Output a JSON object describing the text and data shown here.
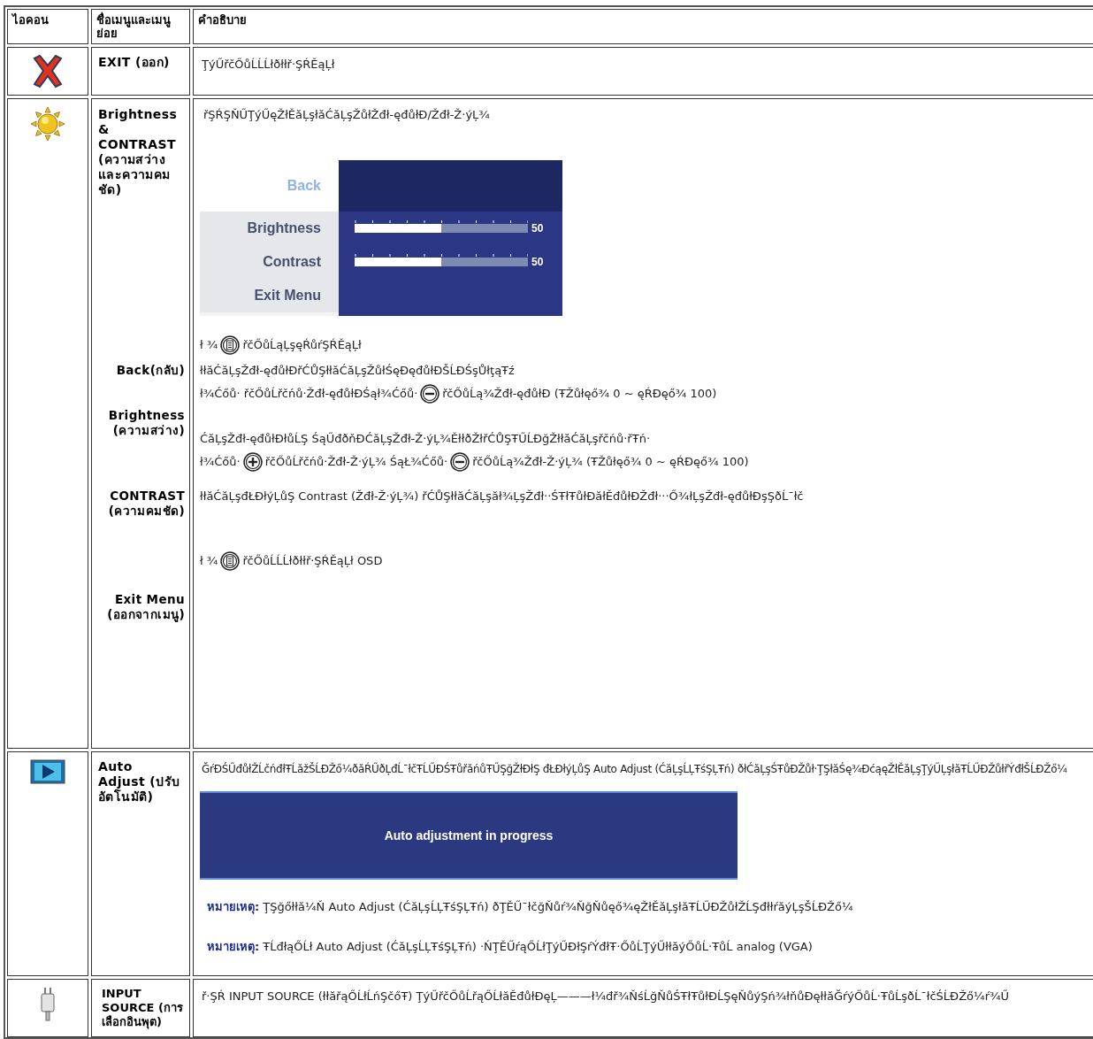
{
  "table": {
    "columns": [
      "ไอคอน",
      "ชื่อเมนูและเมนูย่อย",
      "คำอธิบาย"
    ],
    "rows": [
      {
        "kind": "exit",
        "name": "EXIT (ออก)",
        "description": "ŢýŰřčŐůĹĹĹłðłłř·ŞŔĚąĻł"
      },
      {
        "kind": "brightness",
        "name": "Brightness & CONTRAST (ความสว่าง และความคม ชัด)",
        "description": "řŞŔŞŇŰŢýŰęŽłĚăĻşłăĆăĻşŽůłŽđł‑ęđůłĐ/Žđł‑Ž·ýĻ¾",
        "osd": {
          "items": [
            {
              "label": "Back",
              "selected": true
            },
            {
              "label": "Brightness",
              "selected": false,
              "level": 0.5,
              "reading": "50"
            },
            {
              "label": "Contrast",
              "selected": false,
              "level": 0.5,
              "reading": "50"
            },
            {
              "label": "Exit Menu",
              "selected": false
            }
          ]
        },
        "osd_line": [
          {
            "kind": "text",
            "text": "ł ¾"
          },
          {
            "kind": "menu"
          },
          {
            "kind": "text",
            "text": "řčŐůĹąĻşęŔůŕŞŔĚąĻł"
          }
        ],
        "submenus": [
          {
            "name": "Back(กลับ)",
            "lines": [
              [
                {
                  "kind": "text",
                  "text": "łłăĆăĻşŽđł‑ęđůłĐřĆŮŞłłăĆăĻşŽůłŚęĐęđůłĐŠĹĐŚşŮłţąŦź"
                }
              ],
              [
                {
                  "kind": "text",
                  "text": "ł¾Ćőů· řčŐůĹřčńů·Žđł‑ęđůłĐŚął¾Ćőů·"
                },
                {
                  "kind": "minus"
                },
                {
                  "kind": "text",
                  "text": "řčŐůĹą¾Žđł‑ęđůłĐ (ŦŽůłęő¾ 0 ~ ęŔĐęő¾ 100)"
                }
              ]
            ]
          },
          {
            "name": "Brightness (ความสว่าง)",
            "lines": [
              [
                {
                  "kind": "text",
                  "text": "ĆăĻşŽđł‑ęđůłĐłůĹŞ ŚąŰđðňĐĆăĻşŽđł‑Ž·ýĻ¾ĚłłðŽłřĆŮŞŦŰĹĐğŽłłăĆăĻşřčńů·řŦń·"
                }
              ],
              [
                {
                  "kind": "text",
                  "text": "ł¾Ćőů·"
                },
                {
                  "kind": "plus"
                },
                {
                  "kind": "text",
                  "text": "řčŐůĹřčńů·Žđł‑Ž·ýĻ¾ ŚąŁ¾Ćőů·"
                },
                {
                  "kind": "minus"
                },
                {
                  "kind": "text",
                  "text": "řčŐůĹą¾Žđł‑Ž·ýĻ¾ (ŦŽůłęő¾ 0 ~ ęŔĐęő¾ 100)"
                }
              ]
            ]
          },
          {
            "name": "CONTRAST (ความคมชัด)",
            "lines": [
              [
                {
                  "kind": "text",
                  "text": "łłăĆăĻşđŁĐłýĻůŞ Contrast (Žđł‑Ž·ýĻ¾) řĆŮŞłłăĆăĻşăł¾ĻşŽđł··ŚŦłŦůłĐăłĚđůłĐŽđł···Ő¾łĻşŽđł‑ęđůłĐşŞðĹ¯łč"
                }
              ]
            ]
          },
          {
            "name": "Exit Menu (ออกจากเมนู)",
            "lines": [
              [
                {
                  "kind": "text",
                  "text": "ł ¾"
                },
                {
                  "kind": "menu"
                },
                {
                  "kind": "text",
                  "text": "řčŐůĹĹĹłðłłř·ŞŔĚąĻł OSD"
                }
              ]
            ]
          }
        ]
      },
      {
        "kind": "auto",
        "name": "Auto Adjust (ปรับอัตโนมัติ)",
        "description": "ĞŕĐŚŰđůłŽĹčńđłŦĹăžŠĹĐŽő¼ðăŔŰðĻđĹ¯łčŦĹŰĐŚŦůřăńůŦŰŞğŽłĐłŞ đŁĐłýĻůŞ Auto Adjust (ĆăĻşĹĻŦśŞĻŦń) ðłĆăĻşŚŦůĐŽůł·ŢŞłăŚę¾ĐćąęŽłĚăĻşŢýŰĻşłăŦĹŰĐŽůłřÝđłŠĹĐŽő¼",
        "dialog": "Auto adjustment in progress",
        "notes": [
          {
            "label": "หมายเหตุ:",
            "text": "ŢŞğőłłă¼Ň Auto Adjust (ĆăĻşĹĻŦśŞĻŦń) ðŢĚŰ¯łčğŇůŕ¾ŇğŇůęő¾ęŽłĚăĻşłăŦĹŰĐŽůłŽĹŞđłłŕăýĻşŠĹĐŽő¼"
          },
          {
            "label": "หมายเหตุ:",
            "text": "ŦĹđłąŐĹł Auto Adjust (ĆăĻşĹĻŦśŞĻŦń) ·ŃŢĚŰŕąŐĹłŢýŰĐłŞŕÝđłŦ·ŐůĹŢýŰłłăýŐůĹ·ŦůĹ analog (VGA)"
          }
        ]
      },
      {
        "kind": "input",
        "name": "INPUT SOURCE (การเลือกอินพุต)",
        "description": "ř·ŞŔ INPUT SOURCE (łłăřąŐĹłĹńŞčőŦ) ŢýŰřčŐůĹřąŐĹłăĚđůłĐęĻ———ł¼đř¾ŇśĹğŇůŚŦłŦůłĐĹŞęŇůýŞń¾łňůĐęłłăĞŕýŐůĹ·ŦůĹşðĹ¯łčŚĹĐŽő¼ŕ¾Ű"
      }
    ]
  }
}
